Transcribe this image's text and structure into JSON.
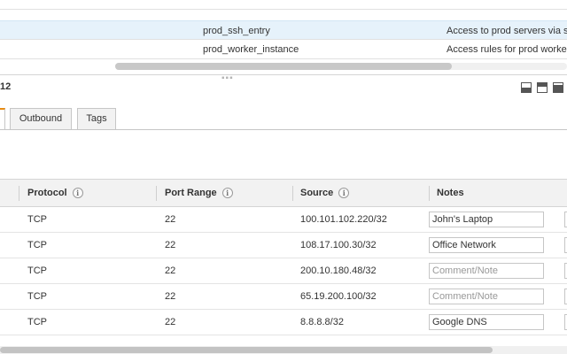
{
  "security_groups": {
    "rows": [
      {
        "name": "prod_ssh_entry",
        "description": "Access to prod servers via ss",
        "selected": true
      },
      {
        "name": "prod_worker_instance",
        "description": "Access rules for prod workers",
        "selected": false
      }
    ]
  },
  "details": {
    "title_fragment": "12"
  },
  "tabs": {
    "items": [
      {
        "label": "Outbound"
      },
      {
        "label": "Tags"
      }
    ],
    "accent_color": "#e88b12"
  },
  "rules_table": {
    "columns": [
      {
        "label": "Protocol",
        "info": true
      },
      {
        "label": "Port Range",
        "info": true
      },
      {
        "label": "Source",
        "info": true
      },
      {
        "label": "Notes",
        "info": false
      }
    ],
    "note_placeholder": "Comment/Note",
    "rows": [
      {
        "protocol": "TCP",
        "port_range": "22",
        "source": "100.101.102.220/32",
        "note": "John's Laptop"
      },
      {
        "protocol": "TCP",
        "port_range": "22",
        "source": "108.17.100.30/32",
        "note": "Office Network"
      },
      {
        "protocol": "TCP",
        "port_range": "22",
        "source": "200.10.180.48/32",
        "note": ""
      },
      {
        "protocol": "TCP",
        "port_range": "22",
        "source": "65.19.200.100/32",
        "note": ""
      },
      {
        "protocol": "TCP",
        "port_range": "22",
        "source": "8.8.8.8/32",
        "note": "Google DNS"
      }
    ]
  },
  "icons": {
    "info": "info-icon",
    "view_modes": [
      "view-bottom-icon",
      "view-top-icon",
      "view-full-icon"
    ]
  }
}
